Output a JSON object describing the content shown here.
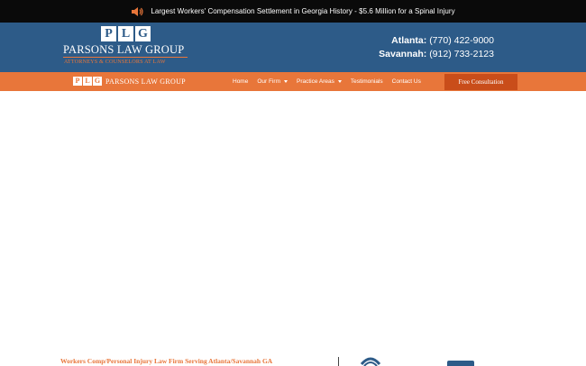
{
  "announcement": {
    "text": "Largest Workers' Compensation Settlement in Georgia History - $5.6 Million for a Spinal Injury",
    "icon": "speaker-icon"
  },
  "header": {
    "logo_monogram": [
      "P",
      "L",
      "G"
    ],
    "logo_name": "PARSONS LAW GROUP",
    "logo_tagline": "ATTORNEYS & COUNSELORS AT LAW",
    "phones": [
      {
        "label": "Atlanta:",
        "number": "(770) 422-9000"
      },
      {
        "label": "Savannah:",
        "number": "(912) 733-2123"
      }
    ]
  },
  "nav": {
    "logo_monogram": [
      "P",
      "L",
      "G"
    ],
    "logo_name": "PARSONS LAW GROUP",
    "items": [
      {
        "label": "Home"
      },
      {
        "label": "Our Firm"
      },
      {
        "label": "Practice Areas"
      },
      {
        "label": "Testimonials"
      },
      {
        "label": "Contact Us"
      }
    ],
    "cta": "Free Consultation"
  },
  "footer": {
    "tagline": "Workers Comp/Personal Injury Law Firm Serving Atlanta/Savannah GA"
  },
  "colors": {
    "topbar": "#0a0a0a",
    "header": "#2d5b88",
    "accent": "#e8763a",
    "cta": "#c94d1a"
  }
}
